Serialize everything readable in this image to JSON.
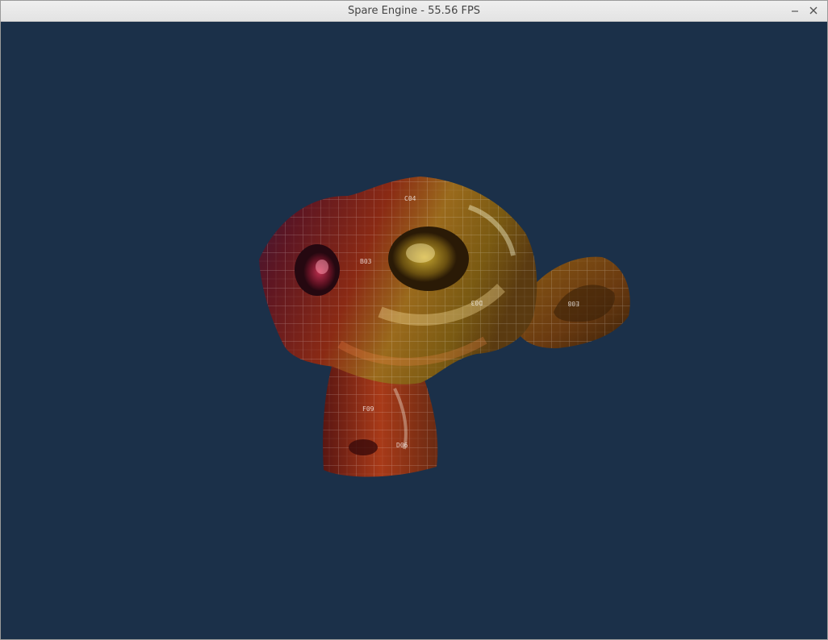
{
  "window": {
    "title": "Spare Engine - 55.56 FPS",
    "controls": {
      "minimize_icon": "minimize-icon",
      "close_icon": "close-icon"
    }
  },
  "viewport": {
    "background_color": "#1b3049",
    "scene_object": "textured-monkey-head-mesh",
    "texture_labels": [
      "E08",
      "D03",
      "F09",
      "D06",
      "B03",
      "C04"
    ]
  }
}
